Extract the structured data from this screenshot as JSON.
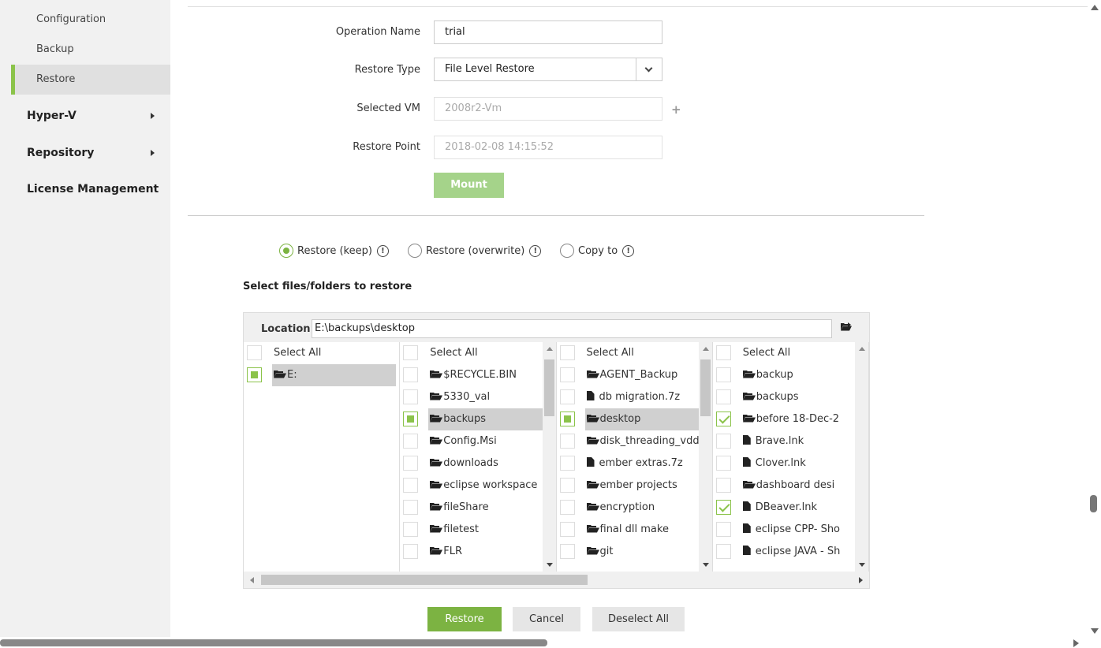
{
  "sidebar": {
    "sub_items": [
      {
        "label": "Configuration",
        "active": false
      },
      {
        "label": "Backup",
        "active": false
      },
      {
        "label": "Restore",
        "active": true
      }
    ],
    "nav_items": [
      {
        "label": "Hyper-V",
        "has_arrow": true
      },
      {
        "label": "Repository",
        "has_arrow": true
      },
      {
        "label": "License Management",
        "has_arrow": false
      }
    ]
  },
  "form": {
    "operation_name_label": "Operation Name",
    "operation_name_value": "trial",
    "restore_type_label": "Restore Type",
    "restore_type_value": "File Level Restore",
    "selected_vm_label": "Selected VM",
    "selected_vm_value": "2008r2-Vm",
    "restore_point_label": "Restore Point",
    "restore_point_value": "2018-02-08 14:15:52",
    "mount_label": "Mount"
  },
  "restore_options": [
    {
      "label": "Restore (keep)",
      "checked": true
    },
    {
      "label": "Restore (overwrite)",
      "checked": false
    },
    {
      "label": "Copy to",
      "checked": false
    }
  ],
  "info_glyph": "!",
  "browser": {
    "section_title": "Select files/folders to restore",
    "location_label": "Location",
    "location_value": "E:\\backups\\desktop",
    "columns": [
      {
        "select_all": "Select All",
        "items": [
          {
            "label": "E:",
            "type": "folder",
            "state": "partial",
            "selected": true
          }
        ]
      },
      {
        "select_all": "Select All",
        "items": [
          {
            "label": "$RECYCLE.BIN",
            "type": "folder",
            "state": "none",
            "selected": false
          },
          {
            "label": "5330_val",
            "type": "folder",
            "state": "none",
            "selected": false
          },
          {
            "label": "backups",
            "type": "folder",
            "state": "partial",
            "selected": true
          },
          {
            "label": "Config.Msi",
            "type": "folder",
            "state": "none",
            "selected": false
          },
          {
            "label": "downloads",
            "type": "folder",
            "state": "none",
            "selected": false
          },
          {
            "label": "eclipse workspace",
            "type": "folder",
            "state": "none",
            "selected": false
          },
          {
            "label": "fileShare",
            "type": "folder",
            "state": "none",
            "selected": false
          },
          {
            "label": "filetest",
            "type": "folder",
            "state": "none",
            "selected": false
          },
          {
            "label": "FLR",
            "type": "folder",
            "state": "none",
            "selected": false
          }
        ]
      },
      {
        "select_all": "Select All",
        "items": [
          {
            "label": "AGENT_Backup",
            "type": "folder",
            "state": "none",
            "selected": false
          },
          {
            "label": "db migration.7z",
            "type": "file",
            "state": "none",
            "selected": false
          },
          {
            "label": "desktop",
            "type": "folder",
            "state": "partial",
            "selected": true
          },
          {
            "label": "disk_threading_vddk",
            "type": "folder",
            "state": "none",
            "selected": false
          },
          {
            "label": "ember extras.7z",
            "type": "file",
            "state": "none",
            "selected": false
          },
          {
            "label": "ember projects",
            "type": "folder",
            "state": "none",
            "selected": false
          },
          {
            "label": "encryption",
            "type": "folder",
            "state": "none",
            "selected": false
          },
          {
            "label": "final dll make",
            "type": "folder",
            "state": "none",
            "selected": false
          },
          {
            "label": "git",
            "type": "folder",
            "state": "none",
            "selected": false
          }
        ]
      },
      {
        "select_all": "Select All",
        "items": [
          {
            "label": "backup",
            "type": "folder",
            "state": "none",
            "selected": false
          },
          {
            "label": "backups",
            "type": "folder",
            "state": "none",
            "selected": false
          },
          {
            "label": "before 18-Dec-2",
            "type": "folder",
            "state": "checked",
            "selected": false
          },
          {
            "label": "Brave.lnk",
            "type": "file",
            "state": "none",
            "selected": false
          },
          {
            "label": "Clover.lnk",
            "type": "file",
            "state": "none",
            "selected": false
          },
          {
            "label": "dashboard desi",
            "type": "folder",
            "state": "none",
            "selected": false
          },
          {
            "label": "DBeaver.lnk",
            "type": "file",
            "state": "checked",
            "selected": false
          },
          {
            "label": "eclipse CPP- Sho",
            "type": "file",
            "state": "none",
            "selected": false
          },
          {
            "label": "eclipse JAVA - Sh",
            "type": "file",
            "state": "none",
            "selected": false
          }
        ]
      }
    ]
  },
  "actions": {
    "restore_label": "Restore",
    "cancel_label": "Cancel",
    "deselect_all_label": "Deselect All"
  },
  "colors": {
    "accent": "#7cb342",
    "accent_light": "#a5d38a",
    "sidebar_bg": "#f1f1f1"
  }
}
